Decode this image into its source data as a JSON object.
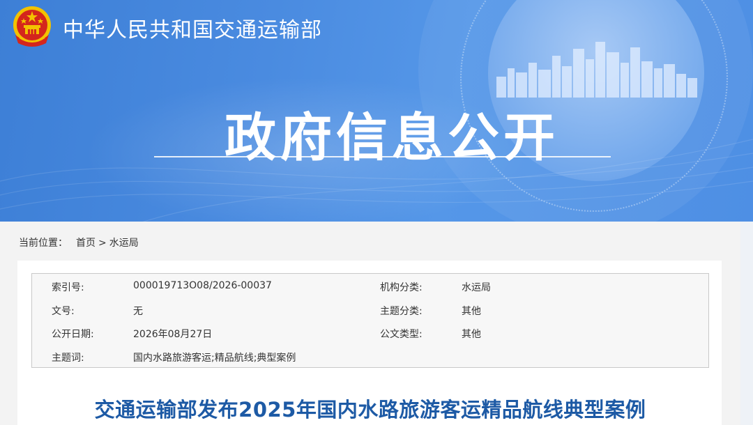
{
  "header": {
    "ministry_name": "中华人民共和国交通运输部",
    "banner_title": "政府信息公开"
  },
  "breadcrumb": {
    "label": "当前位置：",
    "items": [
      "首页",
      "水运局"
    ],
    "separator": ">"
  },
  "meta": {
    "index_no": {
      "label": "索引号:",
      "value": "000019713O08/2026-00037"
    },
    "doc_no": {
      "label": "文号:",
      "value": "无"
    },
    "pub_date": {
      "label": "公开日期:",
      "value": "2026年08月27日"
    },
    "keywords": {
      "label": "主题词:",
      "value": "国内水路旅游客运;精品航线;典型案例"
    },
    "org_cat": {
      "label": "机构分类:",
      "value": "水运局"
    },
    "topic_cat": {
      "label": "主题分类:",
      "value": "其他"
    },
    "doc_type": {
      "label": "公文类型:",
      "value": "其他"
    }
  },
  "article": {
    "title": "交通运输部发布2025年国内水路旅游客运精品航线典型案例"
  },
  "colors": {
    "banner": "#4a8be0",
    "title": "#1d5aa5",
    "emblem_red": "#d4261c",
    "emblem_gold": "#f3c200"
  },
  "icons": {
    "emblem": "national-emblem-icon"
  }
}
